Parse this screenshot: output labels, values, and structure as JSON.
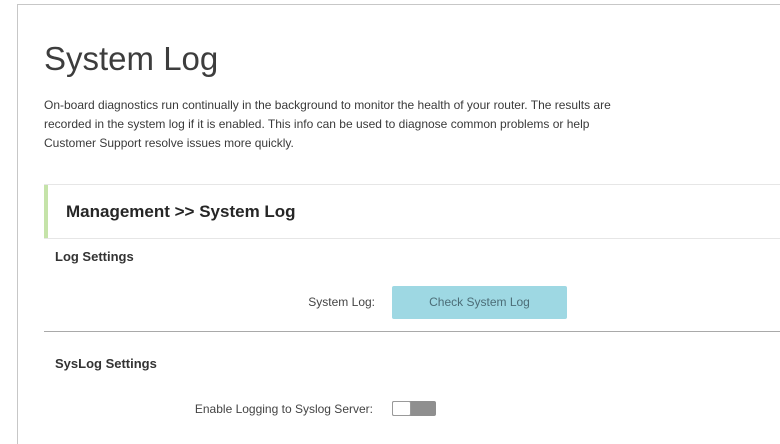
{
  "page": {
    "title": "System Log",
    "intro": "On-board diagnostics run continually in the background to monitor the health of your router. The results are recorded in the system log if it is enabled. This info can be used to diagnose common problems or help Customer Support resolve issues more quickly."
  },
  "section": {
    "title": "Management >> System Log",
    "accent_color": "#c5e3a9"
  },
  "log_settings": {
    "heading": "Log Settings",
    "system_log_label": "System Log:",
    "check_button_label": "Check System Log",
    "button_color": "#9ed8e3"
  },
  "syslog_settings": {
    "heading": "SysLog Settings",
    "enable_label": "Enable Logging to Syslog Server:",
    "enable_state": "off"
  }
}
